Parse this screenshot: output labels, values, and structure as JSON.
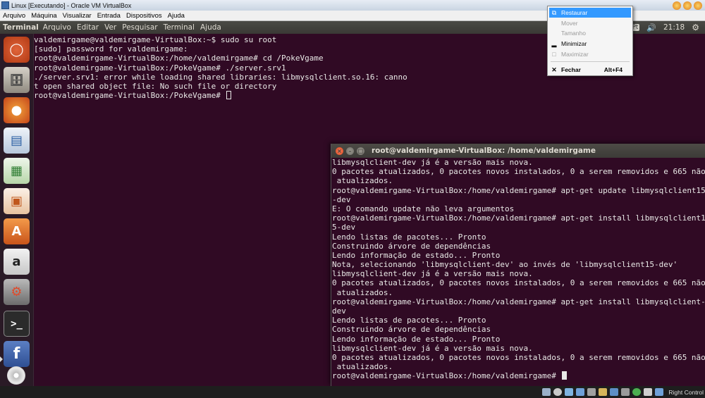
{
  "vbox": {
    "window_title": "Linux [Executando] - Oracle VM VirtualBox",
    "menu": [
      "Arquivo",
      "Máquina",
      "Visualizar",
      "Entrada",
      "Dispositivos",
      "Ajuda"
    ]
  },
  "panel": {
    "app_name": "Terminal",
    "menus": [
      "Arquivo",
      "Editar",
      "Ver",
      "Pesquisar",
      "Terminal",
      "Ajuda"
    ],
    "keyboard_indicator": "Pt",
    "clock": "21:18"
  },
  "launcher": {
    "icons": [
      "ubuntu-dash-icon",
      "files-icon",
      "firefox-icon",
      "writer-icon",
      "calc-icon",
      "impress-icon",
      "software-center-icon",
      "amazon-icon",
      "system-settings-icon",
      "terminal-icon",
      "facebook-icon",
      "disc-icon"
    ]
  },
  "terminal_main": {
    "lines": [
      "valdemirgame@valdemirgame-VirtualBox:~$ sudo su root",
      "[sudo] password for valdemirgame:",
      "root@valdemirgame-VirtualBox:/home/valdemirgame# cd /PokeVgame",
      "root@valdemirgame-VirtualBox:/PokeVgame# ./server.srv1",
      "./server.srv1: error while loading shared libraries: libmysqlclient.so.16: canno",
      "t open shared object file: No such file or directory"
    ],
    "prompt": "root@valdemirgame-VirtualBox:/PokeVgame# "
  },
  "terminal_second": {
    "title": "root@valdemirgame-VirtualBox: /home/valdemirgame",
    "lines": [
      "libmysqlclient-dev já é a versão mais nova.",
      "0 pacotes atualizados, 0 pacotes novos instalados, 0 a serem removidos e 665 não",
      " atualizados.",
      "root@valdemirgame-VirtualBox:/home/valdemirgame# apt-get update libmysqlclient15",
      "-dev",
      "E: O comando update não leva argumentos",
      "root@valdemirgame-VirtualBox:/home/valdemirgame# apt-get install libmysqlclient1",
      "5-dev",
      "Lendo listas de pacotes... Pronto",
      "Construindo árvore de dependências",
      "Lendo informação de estado... Pronto",
      "Nota, selecionando 'libmysqlclient-dev' ao invés de 'libmysqlclient15-dev'",
      "libmysqlclient-dev já é a versão mais nova.",
      "0 pacotes atualizados, 0 pacotes novos instalados, 0 a serem removidos e 665 não",
      " atualizados.",
      "root@valdemirgame-VirtualBox:/home/valdemirgame# apt-get install libmysqlclient-",
      "dev",
      "Lendo listas de pacotes... Pronto",
      "Construindo árvore de dependências",
      "Lendo informação de estado... Pronto",
      "libmysqlclient-dev já é a versão mais nova.",
      "0 pacotes atualizados, 0 pacotes novos instalados, 0 a serem removidos e 665 não",
      " atualizados."
    ],
    "prompt": "root@valdemirgame-VirtualBox:/home/valdemirgame# "
  },
  "context_menu": {
    "restore": "Restaurar",
    "move": "Mover",
    "size": "Tamanho",
    "minimize": "Minimizar",
    "maximize": "Maximizar",
    "close": "Fechar",
    "close_shortcut": "Alt+F4"
  },
  "host_taskbar": {
    "tray_label": "Right Control"
  }
}
